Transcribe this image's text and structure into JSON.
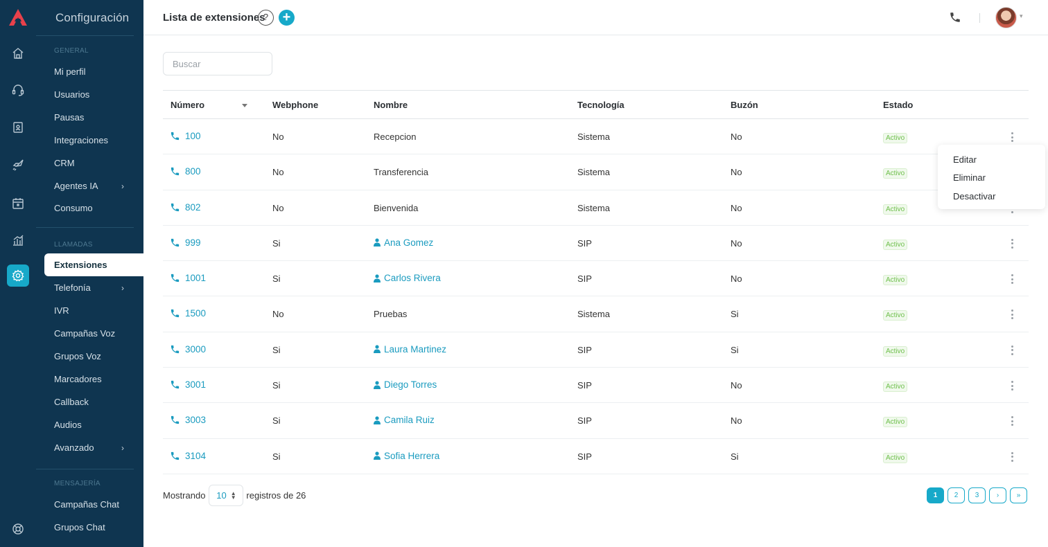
{
  "app": {
    "section_title": "Configuración"
  },
  "colors": {
    "sidebar_bg": "#0f3550",
    "accent": "#17a9c9",
    "status_active": "#6dbf4a"
  },
  "rail": [
    {
      "icon": "home-icon"
    },
    {
      "icon": "headset-icon"
    },
    {
      "icon": "contacts-icon"
    },
    {
      "icon": "rocket-icon"
    },
    {
      "icon": "calendar-icon"
    },
    {
      "icon": "chart-icon"
    },
    {
      "icon": "gear-icon",
      "active": true
    },
    {
      "icon": "support-icon"
    }
  ],
  "sidebar": {
    "general_label": "GENERAL",
    "general": [
      "Mi perfil",
      "Usuarios",
      "Pausas",
      "Integraciones",
      "CRM",
      "Agentes IA",
      "Consumo"
    ],
    "llamadas_label": "LLAMADAS",
    "llamadas": [
      "Extensiones",
      "Telefonía",
      "IVR",
      "Campañas Voz",
      "Grupos Voz",
      "Marcadores",
      "Callback",
      "Audios",
      "Avanzado"
    ],
    "mensajeria_label": "MENSAJERÍA",
    "mensajeria": [
      "Campañas Chat",
      "Grupos Chat"
    ]
  },
  "header": {
    "title": "Lista de extensiones",
    "help": "?",
    "add": "+"
  },
  "search": {
    "placeholder": "Buscar"
  },
  "table": {
    "columns": [
      "Número",
      "Webphone",
      "Nombre",
      "Tecnología",
      "Buzón",
      "Estado"
    ],
    "rows": [
      {
        "numero": "100",
        "webphone": "No",
        "nombre": "Recepcion",
        "tecnologia": "Sistema",
        "buzon": "No",
        "estado": "Activo"
      },
      {
        "numero": "800",
        "webphone": "No",
        "nombre": "Transferencia",
        "tecnologia": "Sistema",
        "buzon": "No",
        "estado": "Activo"
      },
      {
        "numero": "802",
        "webphone": "No",
        "nombre": "Bienvenida",
        "tecnologia": "Sistema",
        "buzon": "No",
        "estado": "Activo"
      },
      {
        "numero": "999",
        "webphone": "Si",
        "nombre": "Ana Gomez",
        "tecnologia": "SIP",
        "buzon": "No",
        "estado": "Activo"
      },
      {
        "numero": "1001",
        "webphone": "Si",
        "nombre": "Carlos Rivera",
        "tecnologia": "SIP",
        "buzon": "No",
        "estado": "Activo"
      },
      {
        "numero": "1500",
        "webphone": "No",
        "nombre": "Pruebas",
        "tecnologia": "Sistema",
        "buzon": "Si",
        "estado": "Activo"
      },
      {
        "numero": "3000",
        "webphone": "Si",
        "nombre": "Laura Martinez",
        "tecnologia": "SIP",
        "buzon": "Si",
        "estado": "Activo"
      },
      {
        "numero": "3001",
        "webphone": "Si",
        "nombre": "Diego Torres",
        "tecnologia": "SIP",
        "buzon": "No",
        "estado": "Activo"
      },
      {
        "numero": "3003",
        "webphone": "Si",
        "nombre": "Camila Ruiz",
        "tecnologia": "SIP",
        "buzon": "No",
        "estado": "Activo"
      },
      {
        "numero": "3104",
        "webphone": "Si",
        "nombre": "Sofia Herrera",
        "tecnologia": "SIP",
        "buzon": "Si",
        "estado": "Activo"
      }
    ]
  },
  "row_menu": [
    "Editar",
    "Eliminar",
    "Desactivar"
  ],
  "footer": {
    "showing": "Mostrando",
    "per_page": "10",
    "suffix": "registros de 26",
    "pages": [
      "1",
      "2",
      "3",
      "›",
      "»"
    ],
    "current_page": "1"
  }
}
